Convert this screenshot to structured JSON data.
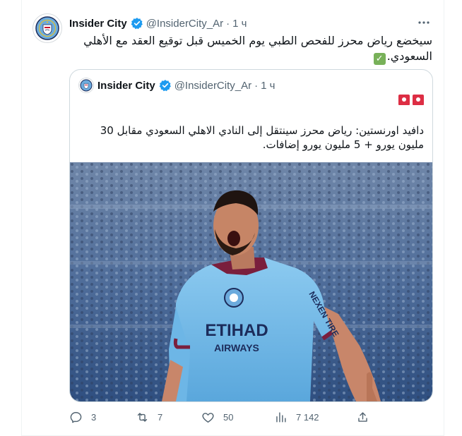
{
  "colors": {
    "accent": "#1d9bf0",
    "text": "#0f1419",
    "muted": "#536471",
    "border": "#cfd9de"
  },
  "tweet": {
    "author_name": "Insider City",
    "handle": "@InsiderCity_Ar",
    "separator": "·",
    "time": "1 ч",
    "text": "سيخضع رياض محرز للفحص الطبي يوم الخميس قبل توقيع العقد مع الأهلي السعودي.",
    "text_emoji": "white-heavy-check-mark-icon"
  },
  "quote": {
    "author_name": "Insider City",
    "handle": "@InsiderCity_Ar",
    "separator": "·",
    "time": "1 ч",
    "emoji": "police-siren-icon ×2",
    "text": "دافيد اورنستين: رياض محرز سينتقل إلى النادي الاهلي السعودي مقابل 30 مليون يورو + 5 مليون يورو إضافات.",
    "image_alt": "football-player-celebrating-photo",
    "jersey_text": "ETIHAD AIRWAYS"
  },
  "actions": {
    "replies": "3",
    "retweets": "7",
    "likes": "50",
    "views": "7 142"
  }
}
